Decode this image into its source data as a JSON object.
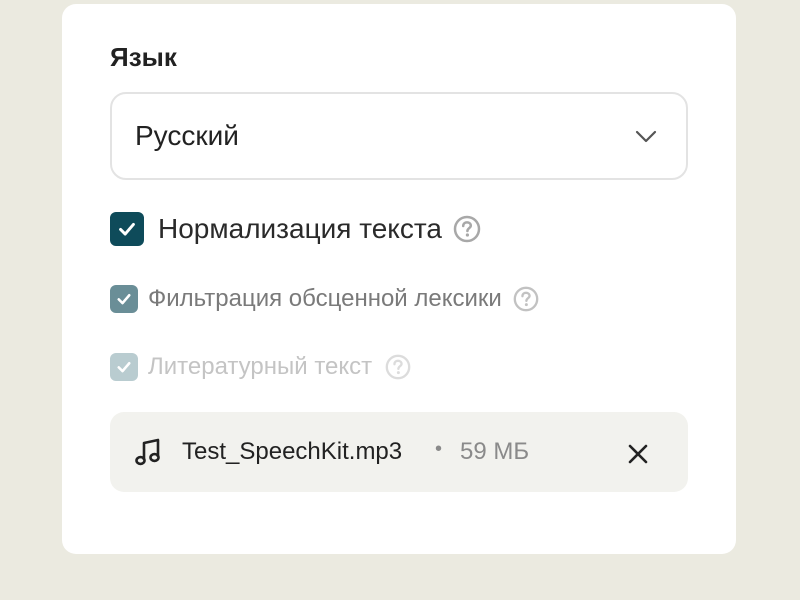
{
  "language": {
    "label": "Язык",
    "selected": "Русский"
  },
  "options": [
    {
      "label": "Нормализация текста",
      "checked": true,
      "state": "enabled"
    },
    {
      "label": "Фильтрация обсценной лексики",
      "checked": true,
      "state": "enabled"
    },
    {
      "label": "Литературный текст",
      "checked": true,
      "state": "disabled"
    }
  ],
  "file": {
    "name": "Test_SpeechKit.mp3",
    "separator": "•",
    "size": "59 МБ",
    "icon": "music-note-icon",
    "remove_icon": "close-icon"
  },
  "colors": {
    "checkbox_primary": "#0e4b5a",
    "page_background": "#ebeae0",
    "file_chip": "#f2f2ee"
  }
}
